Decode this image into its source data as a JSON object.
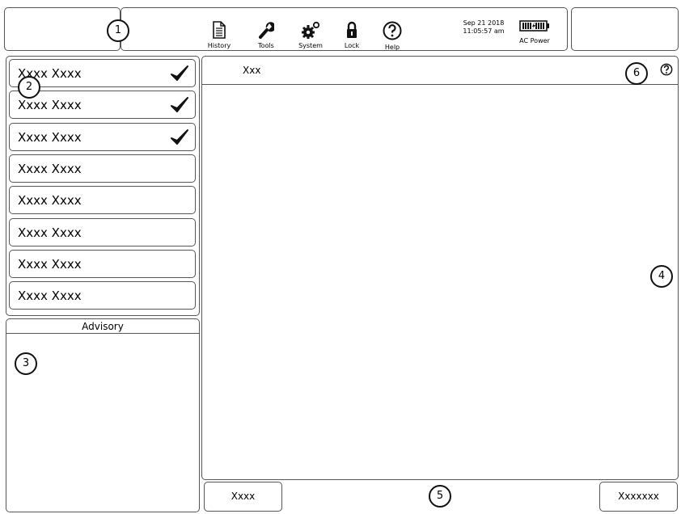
{
  "header": {
    "toolbar": [
      {
        "label": "History",
        "icon": "document-icon"
      },
      {
        "label": "Tools",
        "icon": "wrench-icon"
      },
      {
        "label": "System",
        "icon": "gears-icon"
      },
      {
        "label": "Lock",
        "icon": "lock-icon"
      },
      {
        "label": "Help",
        "icon": "help-icon"
      }
    ],
    "date": "Sep 21 2018",
    "time": "11:05:57 am",
    "power_label": "AC Power"
  },
  "list": {
    "items": [
      {
        "label": "Xxxx Xxxx",
        "checked": true
      },
      {
        "label": "Xxxx Xxxx",
        "checked": true
      },
      {
        "label": "Xxxx Xxxx",
        "checked": true
      },
      {
        "label": "Xxxx Xxxx",
        "checked": false
      },
      {
        "label": "Xxxx Xxxx",
        "checked": false
      },
      {
        "label": "Xxxx Xxxx",
        "checked": false
      },
      {
        "label": "Xxxx Xxxx",
        "checked": false
      },
      {
        "label": "Xxxx Xxxx",
        "checked": false
      }
    ]
  },
  "advisory": {
    "title": "Advisory"
  },
  "main": {
    "title": "Xxx"
  },
  "footer": {
    "left_button": "Xxxx",
    "right_button": "Xxxxxxx"
  },
  "callouts": [
    "1",
    "2",
    "3",
    "4",
    "5",
    "6"
  ]
}
